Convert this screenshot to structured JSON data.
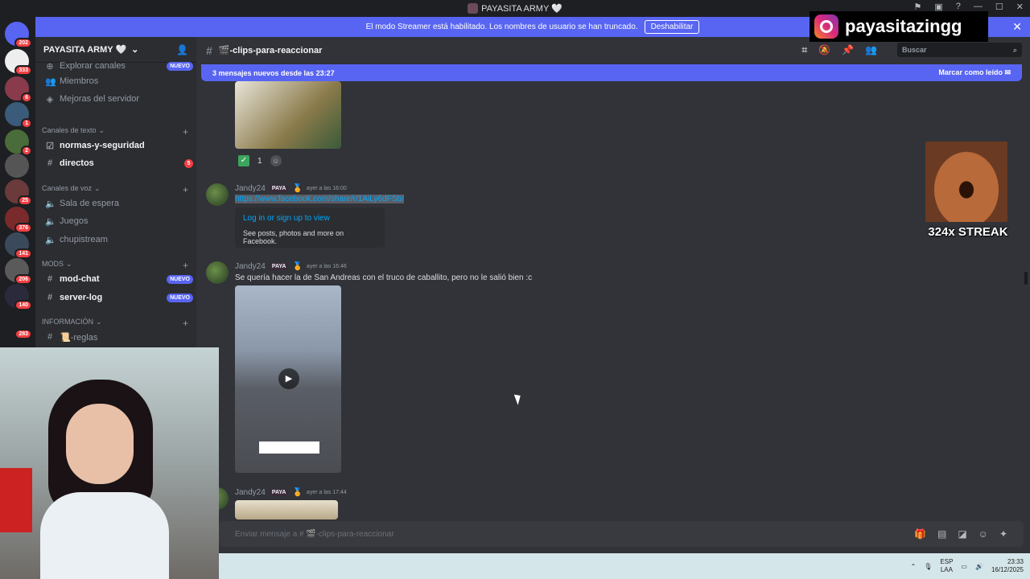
{
  "window": {
    "title": "PAYASITA ARMY 🤍"
  },
  "banner": {
    "text": "El modo Streamer está habilitado. Los nombres de usuario se han truncado.",
    "button": "Deshabilitar"
  },
  "server_list": [
    {
      "badge": "202"
    },
    {
      "badge": "333"
    },
    {
      "badge": "6"
    },
    {
      "badge": "1"
    },
    {
      "badge": "2"
    },
    {
      "badge": ""
    },
    {
      "badge": "25"
    },
    {
      "badge": "376"
    },
    {
      "badge": "141"
    },
    {
      "badge": "206"
    },
    {
      "badge": "140"
    },
    {
      "badge": "283"
    }
  ],
  "sidebar": {
    "server_name": "PAYASITA ARMY 🤍",
    "top_items": [
      {
        "label": "Explorar canales",
        "pill": "NUEVO"
      },
      {
        "label": "Miembros"
      },
      {
        "label": "Mejoras del servidor"
      }
    ],
    "categories": {
      "text": "Canales de texto",
      "voice": "Canales de voz",
      "mods": "MODS",
      "info": "INFORMACIÓN"
    },
    "text_channels": [
      {
        "label": "normas-y-seguridad"
      },
      {
        "label": "directos",
        "badge": "5"
      }
    ],
    "voice_channels": [
      {
        "label": "Sala de espera"
      },
      {
        "label": "Juegos"
      },
      {
        "label": "chupistream"
      }
    ],
    "mod_channels": [
      {
        "label": "mod-chat",
        "pill": "NUEVO"
      },
      {
        "label": "server-log",
        "pill": "NUEVO"
      }
    ],
    "info_channels": [
      {
        "label": "📜-reglas"
      }
    ]
  },
  "channel_header": {
    "name": "🎬-clips-para-reaccionar",
    "search_placeholder": "Buscar"
  },
  "new_messages_bar": {
    "text": "3 mensajes nuevos desde las 23:27",
    "action": "Marcar como leído"
  },
  "messages": [
    {
      "reaction_count": "1"
    },
    {
      "author": "Jandy24",
      "tag": "PAYA",
      "timestamp": "ayer a las 16:00",
      "link": "https://www.facebook.com/share/r/1AiLy6dFSb/",
      "embed_title": "Log in or sign up to view",
      "embed_desc": "See posts, photos and more on Facebook."
    },
    {
      "author": "Jandy24",
      "tag": "PAYA",
      "timestamp": "ayer a las 16:46",
      "text": "Se quería hacer la de San Andreas con el truco de caballito, pero no le salió bien :c"
    },
    {
      "author": "Jandy24",
      "tag": "PAYA",
      "timestamp": "ayer a las 17:44"
    }
  ],
  "input": {
    "placeholder": "Enviar mensaje a # 🎬-clips-para-reaccionar"
  },
  "overlay": {
    "instagram": "payasitazingg",
    "streak": "324x STREAK"
  },
  "taskbar": {
    "lang_top": "ESP",
    "lang_bottom": "LAA",
    "time": "23:33",
    "date": "16/12/2025"
  }
}
